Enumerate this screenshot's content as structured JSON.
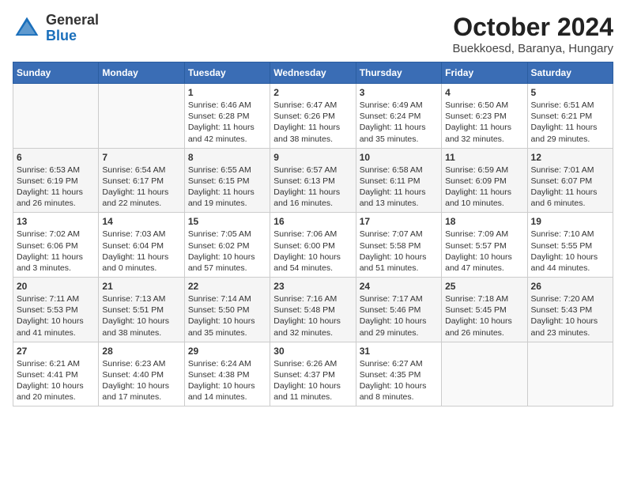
{
  "header": {
    "logo_general": "General",
    "logo_blue": "Blue",
    "month": "October 2024",
    "location": "Buekkoesd, Baranya, Hungary"
  },
  "days_of_week": [
    "Sunday",
    "Monday",
    "Tuesday",
    "Wednesday",
    "Thursday",
    "Friday",
    "Saturday"
  ],
  "weeks": [
    [
      {
        "day": "",
        "info": ""
      },
      {
        "day": "",
        "info": ""
      },
      {
        "day": "1",
        "info": "Sunrise: 6:46 AM\nSunset: 6:28 PM\nDaylight: 11 hours and 42 minutes."
      },
      {
        "day": "2",
        "info": "Sunrise: 6:47 AM\nSunset: 6:26 PM\nDaylight: 11 hours and 38 minutes."
      },
      {
        "day": "3",
        "info": "Sunrise: 6:49 AM\nSunset: 6:24 PM\nDaylight: 11 hours and 35 minutes."
      },
      {
        "day": "4",
        "info": "Sunrise: 6:50 AM\nSunset: 6:23 PM\nDaylight: 11 hours and 32 minutes."
      },
      {
        "day": "5",
        "info": "Sunrise: 6:51 AM\nSunset: 6:21 PM\nDaylight: 11 hours and 29 minutes."
      }
    ],
    [
      {
        "day": "6",
        "info": "Sunrise: 6:53 AM\nSunset: 6:19 PM\nDaylight: 11 hours and 26 minutes."
      },
      {
        "day": "7",
        "info": "Sunrise: 6:54 AM\nSunset: 6:17 PM\nDaylight: 11 hours and 22 minutes."
      },
      {
        "day": "8",
        "info": "Sunrise: 6:55 AM\nSunset: 6:15 PM\nDaylight: 11 hours and 19 minutes."
      },
      {
        "day": "9",
        "info": "Sunrise: 6:57 AM\nSunset: 6:13 PM\nDaylight: 11 hours and 16 minutes."
      },
      {
        "day": "10",
        "info": "Sunrise: 6:58 AM\nSunset: 6:11 PM\nDaylight: 11 hours and 13 minutes."
      },
      {
        "day": "11",
        "info": "Sunrise: 6:59 AM\nSunset: 6:09 PM\nDaylight: 11 hours and 10 minutes."
      },
      {
        "day": "12",
        "info": "Sunrise: 7:01 AM\nSunset: 6:07 PM\nDaylight: 11 hours and 6 minutes."
      }
    ],
    [
      {
        "day": "13",
        "info": "Sunrise: 7:02 AM\nSunset: 6:06 PM\nDaylight: 11 hours and 3 minutes."
      },
      {
        "day": "14",
        "info": "Sunrise: 7:03 AM\nSunset: 6:04 PM\nDaylight: 11 hours and 0 minutes."
      },
      {
        "day": "15",
        "info": "Sunrise: 7:05 AM\nSunset: 6:02 PM\nDaylight: 10 hours and 57 minutes."
      },
      {
        "day": "16",
        "info": "Sunrise: 7:06 AM\nSunset: 6:00 PM\nDaylight: 10 hours and 54 minutes."
      },
      {
        "day": "17",
        "info": "Sunrise: 7:07 AM\nSunset: 5:58 PM\nDaylight: 10 hours and 51 minutes."
      },
      {
        "day": "18",
        "info": "Sunrise: 7:09 AM\nSunset: 5:57 PM\nDaylight: 10 hours and 47 minutes."
      },
      {
        "day": "19",
        "info": "Sunrise: 7:10 AM\nSunset: 5:55 PM\nDaylight: 10 hours and 44 minutes."
      }
    ],
    [
      {
        "day": "20",
        "info": "Sunrise: 7:11 AM\nSunset: 5:53 PM\nDaylight: 10 hours and 41 minutes."
      },
      {
        "day": "21",
        "info": "Sunrise: 7:13 AM\nSunset: 5:51 PM\nDaylight: 10 hours and 38 minutes."
      },
      {
        "day": "22",
        "info": "Sunrise: 7:14 AM\nSunset: 5:50 PM\nDaylight: 10 hours and 35 minutes."
      },
      {
        "day": "23",
        "info": "Sunrise: 7:16 AM\nSunset: 5:48 PM\nDaylight: 10 hours and 32 minutes."
      },
      {
        "day": "24",
        "info": "Sunrise: 7:17 AM\nSunset: 5:46 PM\nDaylight: 10 hours and 29 minutes."
      },
      {
        "day": "25",
        "info": "Sunrise: 7:18 AM\nSunset: 5:45 PM\nDaylight: 10 hours and 26 minutes."
      },
      {
        "day": "26",
        "info": "Sunrise: 7:20 AM\nSunset: 5:43 PM\nDaylight: 10 hours and 23 minutes."
      }
    ],
    [
      {
        "day": "27",
        "info": "Sunrise: 6:21 AM\nSunset: 4:41 PM\nDaylight: 10 hours and 20 minutes."
      },
      {
        "day": "28",
        "info": "Sunrise: 6:23 AM\nSunset: 4:40 PM\nDaylight: 10 hours and 17 minutes."
      },
      {
        "day": "29",
        "info": "Sunrise: 6:24 AM\nSunset: 4:38 PM\nDaylight: 10 hours and 14 minutes."
      },
      {
        "day": "30",
        "info": "Sunrise: 6:26 AM\nSunset: 4:37 PM\nDaylight: 10 hours and 11 minutes."
      },
      {
        "day": "31",
        "info": "Sunrise: 6:27 AM\nSunset: 4:35 PM\nDaylight: 10 hours and 8 minutes."
      },
      {
        "day": "",
        "info": ""
      },
      {
        "day": "",
        "info": ""
      }
    ]
  ]
}
